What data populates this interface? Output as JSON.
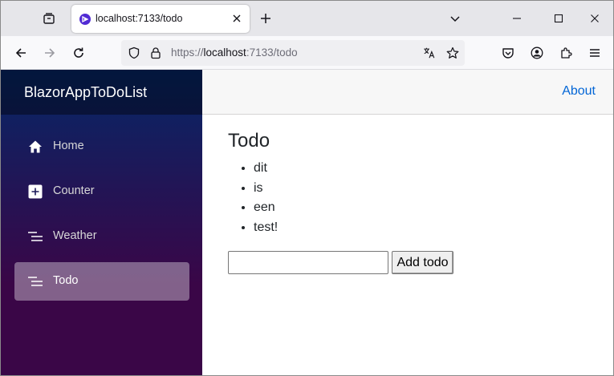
{
  "browser": {
    "tab": {
      "title": "localhost:7133/todo"
    },
    "url": {
      "scheme": "https://",
      "host": "localhost",
      "rest": ":7133/todo"
    }
  },
  "sidebar": {
    "brand": "BlazorAppToDoList",
    "items": [
      {
        "label": "Home",
        "icon": "home-icon",
        "active": false
      },
      {
        "label": "Counter",
        "icon": "plus-square-icon",
        "active": false
      },
      {
        "label": "Weather",
        "icon": "list-icon",
        "active": false
      },
      {
        "label": "Todo",
        "icon": "list-icon",
        "active": true
      }
    ]
  },
  "top_row": {
    "about": "About"
  },
  "main": {
    "title": "Todo",
    "todos": [
      "dit",
      "is",
      "een",
      "test!"
    ],
    "input": {
      "value": "",
      "placeholder": ""
    },
    "add_button": "Add todo"
  },
  "colors": {
    "sidebar_top": "#052767",
    "sidebar_bottom": "#3a0647",
    "link": "#0366d6"
  }
}
